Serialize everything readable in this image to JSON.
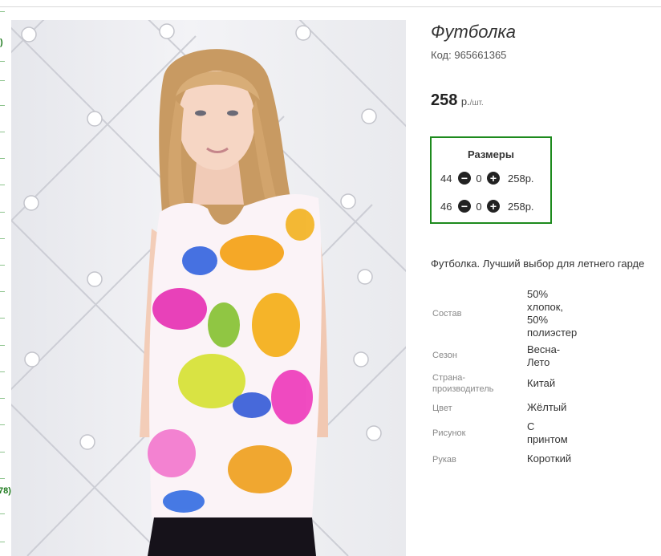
{
  "product": {
    "title": "Футболка",
    "code_label": "Код:",
    "code": "965661365",
    "price": "258",
    "currency": "р.",
    "unit": "/шт.",
    "description": "Футболка. Лучший выбор для летнего гарде"
  },
  "sizes": {
    "title": "Размеры",
    "rows": [
      {
        "size": "44",
        "qty": "0",
        "price": "258р."
      },
      {
        "size": "46",
        "qty": "0",
        "price": "258р."
      }
    ],
    "decrease_icon": "minus-circle-icon",
    "increase_icon": "plus-circle-icon"
  },
  "properties": [
    {
      "label": "Состав",
      "value": "50% хлопок, 50% полиэстер"
    },
    {
      "label": "Сезон",
      "value": "Весна-Лето"
    },
    {
      "label": "Страна-производитель",
      "value": "Китай"
    },
    {
      "label": "Цвет",
      "value": "Жёлтый"
    },
    {
      "label": "Рисунок",
      "value": "С принтом"
    },
    {
      "label": "Рукав",
      "value": "Короткий"
    }
  ],
  "left_column": {
    "bracket_top": ")",
    "bracket_bottom": "78)"
  },
  "colors": {
    "accent_green": "#1d8a1d",
    "text_dark": "#333333"
  }
}
